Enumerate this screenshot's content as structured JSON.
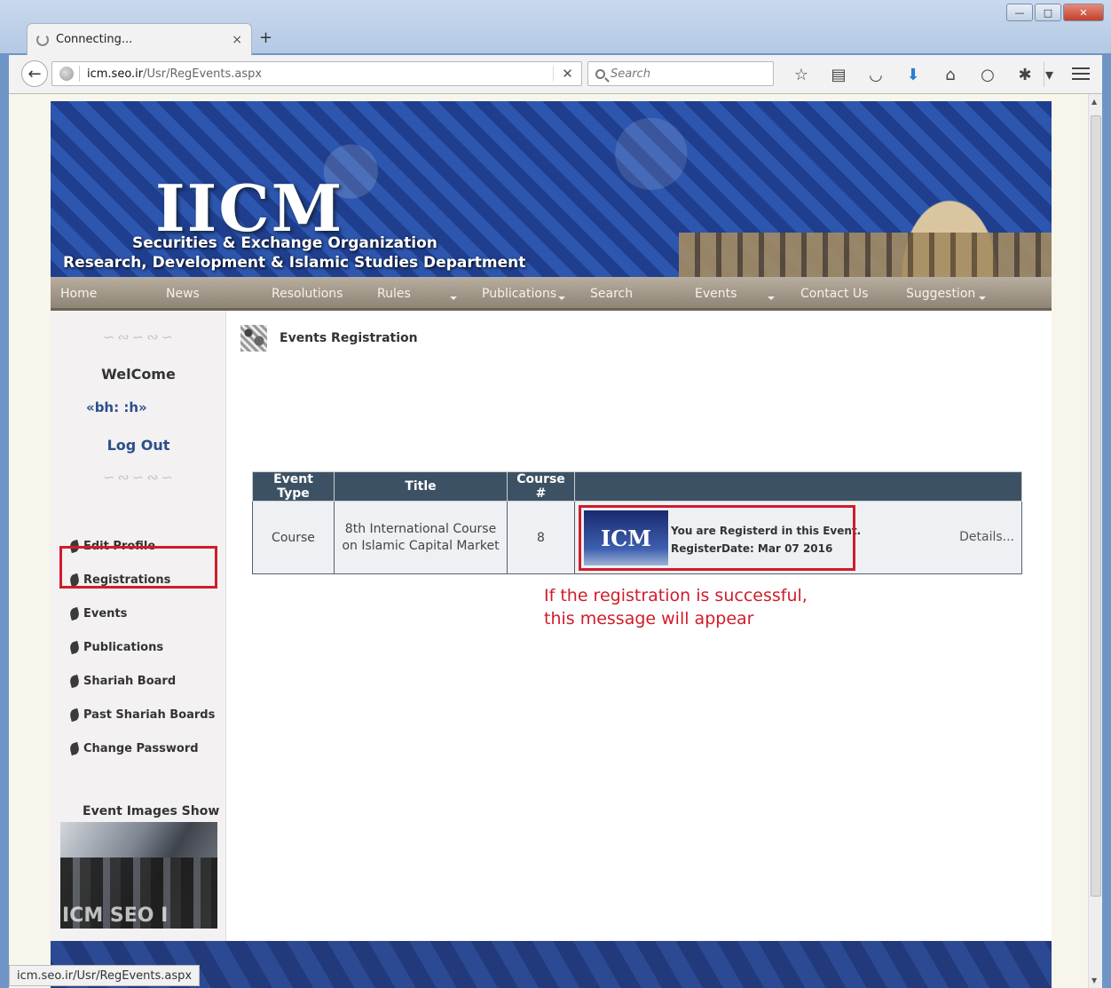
{
  "browser": {
    "tab_title": "Connecting...",
    "tab_close": "×",
    "new_tab": "+",
    "url_host": "icm.seo.ir",
    "url_path": "/Usr/RegEvents.aspx",
    "url_stop": "✕",
    "search_placeholder": "Search",
    "status_url": "icm.seo.ir/Usr/RegEvents.aspx",
    "icons": [
      "star-icon",
      "reading-list-icon",
      "pocket-icon",
      "download-icon",
      "home-icon",
      "chat-icon",
      "extension-icon"
    ]
  },
  "banner": {
    "logo": "IICM",
    "org_line1": "Securities & Exchange Organization",
    "org_line2": "Research, Development & Islamic Studies Department"
  },
  "menu": [
    {
      "label": "Home"
    },
    {
      "label": "News"
    },
    {
      "label": "Resolutions"
    },
    {
      "label": "Rules"
    },
    {
      "label": "Publications"
    },
    {
      "label": "Search"
    },
    {
      "label": "Events"
    },
    {
      "label": "Contact Us"
    },
    {
      "label": "Suggestion"
    }
  ],
  "sidebar": {
    "welcome": "WelCome",
    "username": "«bh:          :h»",
    "logout": "Log Out",
    "links": [
      {
        "label": "Edit Profile"
      },
      {
        "label": "Registrations"
      },
      {
        "label": "Events"
      },
      {
        "label": "Publications"
      },
      {
        "label": "Shariah Board"
      },
      {
        "label": "Past Shariah Boards"
      },
      {
        "label": "Change Password"
      }
    ],
    "images_title": "Event Images Show",
    "photo_watermark": "ICM SEO I"
  },
  "main": {
    "page_title": "Events Registration",
    "table": {
      "headers": [
        "Event Type",
        "Title",
        "Course #",
        ""
      ],
      "rows": [
        {
          "event_type": "Course",
          "title": "8th International Course on Islamic Capital Market",
          "course_no": "8",
          "thumb_text": "ICM",
          "status_line1": "You are Registerd in this Event.",
          "status_line2": "RegisterDate: Mar 07 2016",
          "details": "Details..."
        }
      ]
    },
    "annotation_line1": "If the registration is successful,",
    "annotation_line2": "this message will appear"
  },
  "colors": {
    "highlight": "#d01c2a",
    "table_header": "#3c5264"
  }
}
